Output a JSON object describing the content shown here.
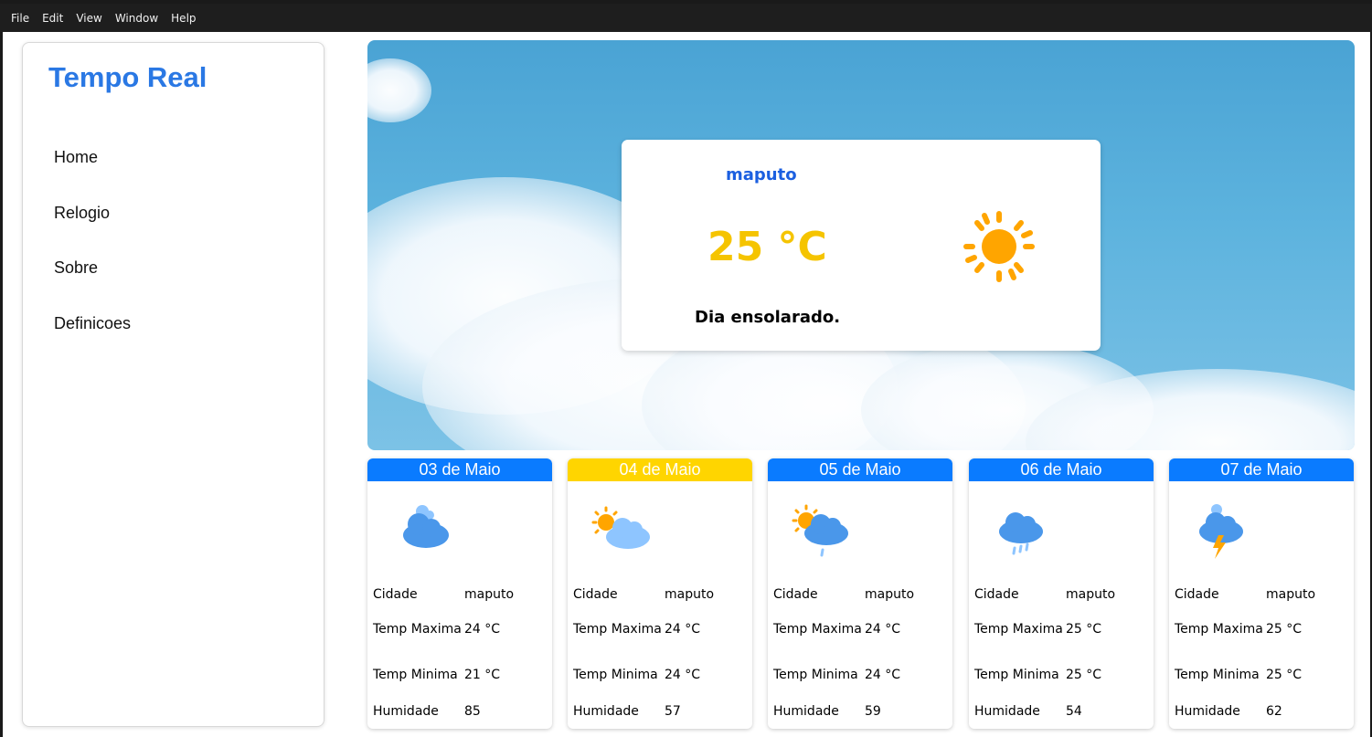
{
  "menu": [
    "File",
    "Edit",
    "View",
    "Window",
    "Help"
  ],
  "app_title": "Tempo Real",
  "nav": [
    "Home",
    "Relogio",
    "Sobre",
    "Definicoes"
  ],
  "current": {
    "city": "maputo",
    "temp": "25 °C",
    "description": "Dia ensolarado.",
    "icon": "sun-icon"
  },
  "labels": {
    "city": "Cidade",
    "tmax": "Temp Maxima",
    "tmin": "Temp Minima",
    "humidity": "Humidade"
  },
  "forecast": [
    {
      "date": "03 de Maio",
      "city": "maputo",
      "tmax": "24 °C",
      "tmin": "21 °C",
      "humidity": "85",
      "icon": "cloud-icon",
      "header_color": "#0a7bff"
    },
    {
      "date": "04 de Maio",
      "city": "maputo",
      "tmax": "24 °C",
      "tmin": "24 °C",
      "humidity": "57",
      "icon": "partly-sunny-icon",
      "header_color": "#ffd500"
    },
    {
      "date": "05 de Maio",
      "city": "maputo",
      "tmax": "24 °C",
      "tmin": "24 °C",
      "humidity": "59",
      "icon": "sun-cloud-rain-icon",
      "header_color": "#0a7bff"
    },
    {
      "date": "06 de Maio",
      "city": "maputo",
      "tmax": "25 °C",
      "tmin": "25 °C",
      "humidity": "54",
      "icon": "rain-cloud-icon",
      "header_color": "#0a7bff"
    },
    {
      "date": "07 de Maio",
      "city": "maputo",
      "tmax": "25 °C",
      "tmin": "25 °C",
      "humidity": "62",
      "icon": "thunderstorm-icon",
      "header_color": "#0a7bff"
    }
  ],
  "colors": {
    "title_blue": "#2a78e4",
    "city_blue": "#1b5fe0",
    "temp_yellow": "#f5c400",
    "sun_orange": "#ffa500"
  }
}
